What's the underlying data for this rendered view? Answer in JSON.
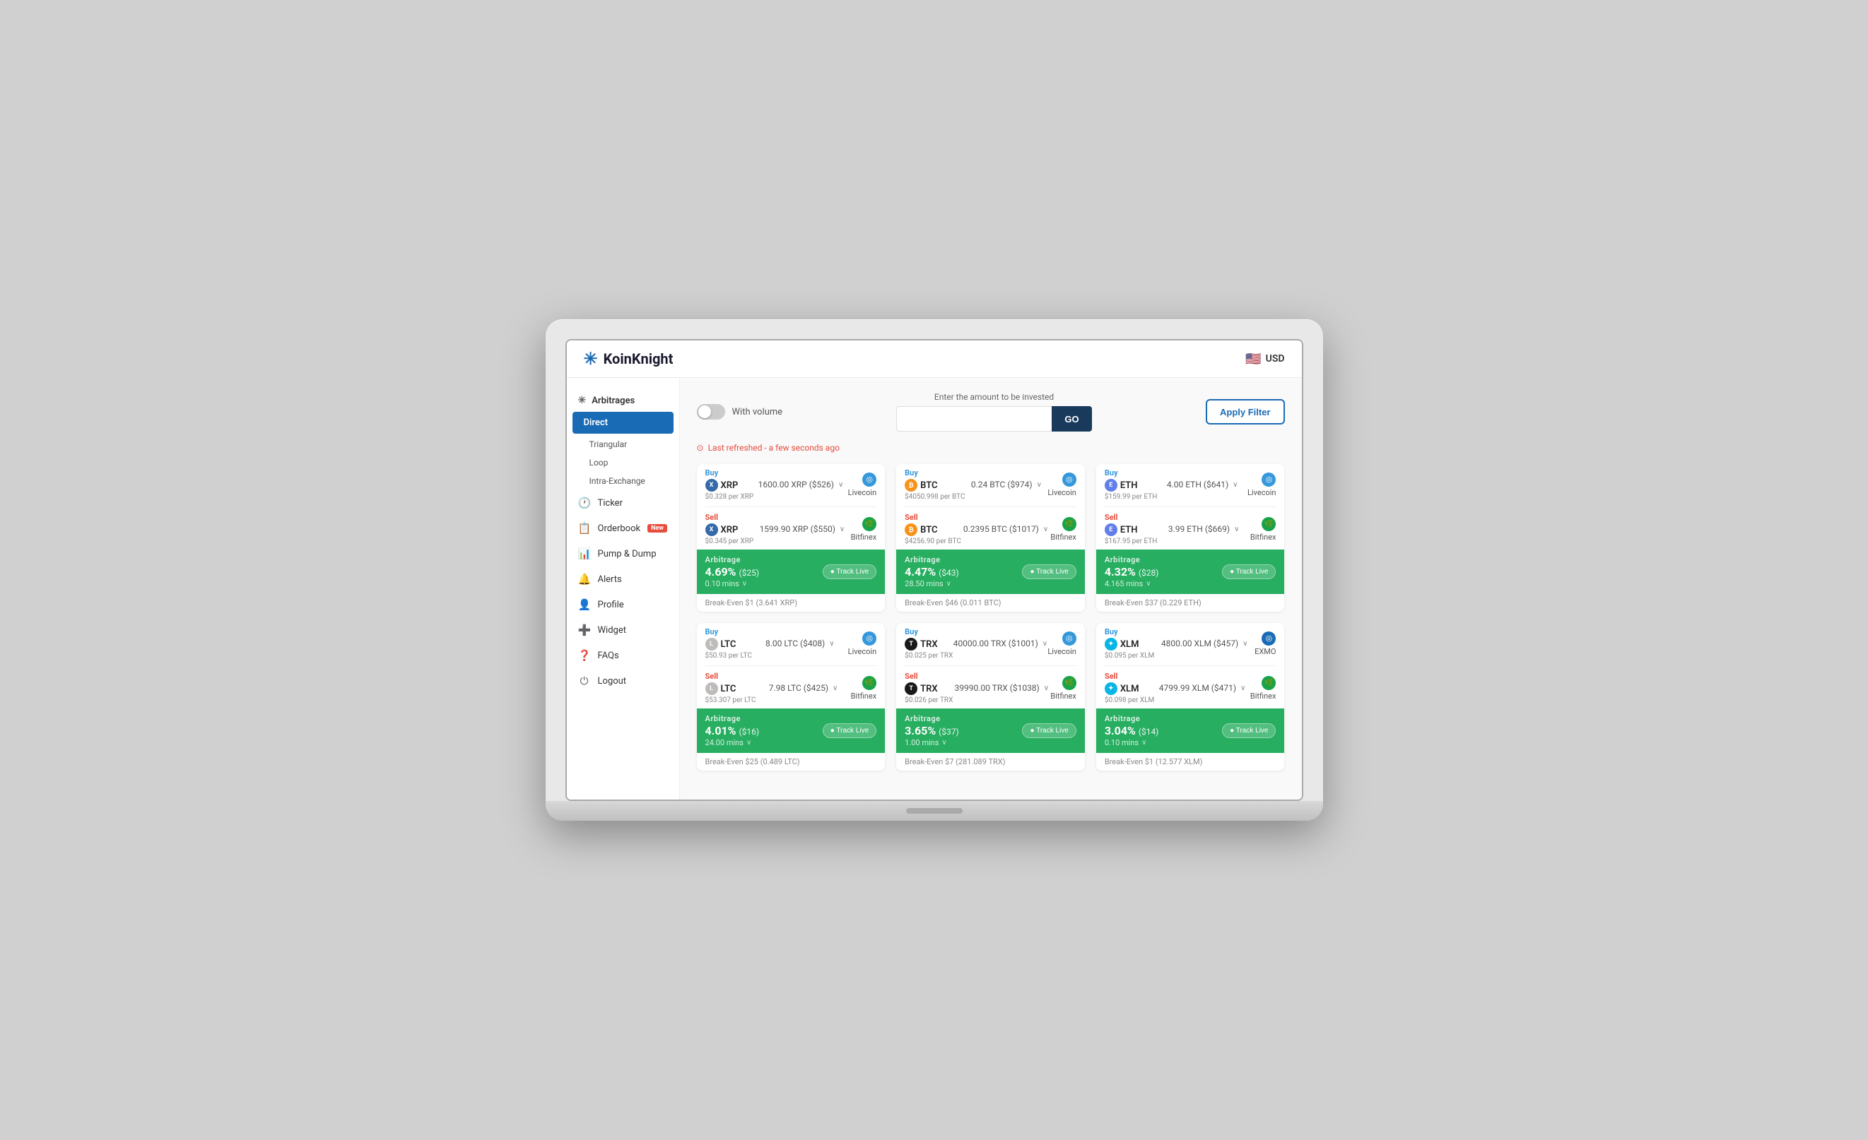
{
  "header": {
    "logo_text": "KoinKnight",
    "currency": "USD",
    "flag": "🇺🇸"
  },
  "sidebar": {
    "arbitrages_label": "Arbitrages",
    "active_item": "Direct",
    "sub_items": [
      "Triangular",
      "Loop",
      "Intra-Exchange"
    ],
    "nav_items": [
      {
        "label": "Ticker",
        "icon": "🕐"
      },
      {
        "label": "Orderbook",
        "icon": "📋",
        "badge": "New"
      },
      {
        "label": "Pump & Dump",
        "icon": "📊"
      },
      {
        "label": "Alerts",
        "icon": "🔔"
      },
      {
        "label": "Profile",
        "icon": "👤"
      },
      {
        "label": "Widget",
        "icon": "➕"
      },
      {
        "label": "FAQs",
        "icon": "❓"
      },
      {
        "label": "Logout",
        "icon": "⏻"
      }
    ]
  },
  "toolbar": {
    "with_volume_label": "With volume",
    "investment_label": "Enter the amount to be invested",
    "go_label": "GO",
    "apply_filter_label": "Apply Filter"
  },
  "last_refreshed": "Last refreshed - a few seconds ago",
  "cards": [
    {
      "buy_action": "Buy",
      "buy_coin": "XRP",
      "buy_amount": "1600.00 XRP ($526)",
      "buy_price": "$0.328 per XRP",
      "buy_exchange": "Livecoin",
      "sell_action": "Sell",
      "sell_coin": "XRP",
      "sell_amount": "1599.90 XRP ($550)",
      "sell_price": "$0.345 per XRP",
      "sell_exchange": "Bitfinex",
      "arb_percent": "4.69%",
      "arb_amount": "($25)",
      "arb_time": "0.10 mins",
      "breakeven": "Break-Even $1 (3.641 XRP)",
      "coin_class": "coin-xrp",
      "coin_letter": "X"
    },
    {
      "buy_action": "Buy",
      "buy_coin": "BTC",
      "buy_amount": "0.24 BTC ($974)",
      "buy_price": "$4050.998 per BTC",
      "buy_exchange": "Livecoin",
      "sell_action": "Sell",
      "sell_coin": "BTC",
      "sell_amount": "0.2395 BTC ($1017)",
      "sell_price": "$4256.90 per BTC",
      "sell_exchange": "Bitfinex",
      "arb_percent": "4.47%",
      "arb_amount": "($43)",
      "arb_time": "28.50 mins",
      "breakeven": "Break-Even $46 (0.011 BTC)",
      "coin_class": "coin-btc",
      "coin_letter": "₿"
    },
    {
      "buy_action": "Buy",
      "buy_coin": "ETH",
      "buy_amount": "4.00 ETH ($641)",
      "buy_price": "$159.99 per ETH",
      "buy_exchange": "Livecoin",
      "sell_action": "Sell",
      "sell_coin": "ETH",
      "sell_amount": "3.99 ETH ($669)",
      "sell_price": "$167.95 per ETH",
      "sell_exchange": "Bitfinex",
      "arb_percent": "4.32%",
      "arb_amount": "($28)",
      "arb_time": "4.165 mins",
      "breakeven": "Break-Even $37 (0.229 ETH)",
      "coin_class": "coin-eth",
      "coin_letter": "E"
    },
    {
      "buy_action": "Buy",
      "buy_coin": "LTC",
      "buy_amount": "8.00 LTC ($408)",
      "buy_price": "$50.93 per LTC",
      "buy_exchange": "Livecoin",
      "sell_action": "Sell",
      "sell_coin": "LTC",
      "sell_amount": "7.98 LTC ($425)",
      "sell_price": "$53.307 per LTC",
      "sell_exchange": "Bitfinex",
      "arb_percent": "4.01%",
      "arb_amount": "($16)",
      "arb_time": "24.00 mins",
      "breakeven": "Break-Even $25 (0.489 LTC)",
      "coin_class": "coin-ltc",
      "coin_letter": "L"
    },
    {
      "buy_action": "Buy",
      "buy_coin": "TRX",
      "buy_amount": "40000.00 TRX ($1001)",
      "buy_price": "$0.025 per TRX",
      "buy_exchange": "Livecoin",
      "sell_action": "Sell",
      "sell_coin": "TRX",
      "sell_amount": "39990.00 TRX ($1038)",
      "sell_price": "$0.026 per TRX",
      "sell_exchange": "Bitfinex",
      "arb_percent": "3.65%",
      "arb_amount": "($37)",
      "arb_time": "1.00 mins",
      "breakeven": "Break-Even $7 (281.089 TRX)",
      "coin_class": "coin-trx",
      "coin_letter": "T"
    },
    {
      "buy_action": "Buy",
      "buy_coin": "XLM",
      "buy_amount": "4800.00 XLM ($457)",
      "buy_price": "$0.095 per XLM",
      "buy_exchange": "EXMO",
      "sell_action": "Sell",
      "sell_coin": "XLM",
      "sell_amount": "4799.99 XLM ($471)",
      "sell_price": "$0.098 per XLM",
      "sell_exchange": "Bitfinex",
      "arb_percent": "3.04%",
      "arb_amount": "($14)",
      "arb_time": "0.10 mins",
      "breakeven": "Break-Even $1 (12.577 XLM)",
      "coin_class": "coin-xlm",
      "coin_letter": "✦"
    }
  ],
  "track_live_label": "● Track Live"
}
